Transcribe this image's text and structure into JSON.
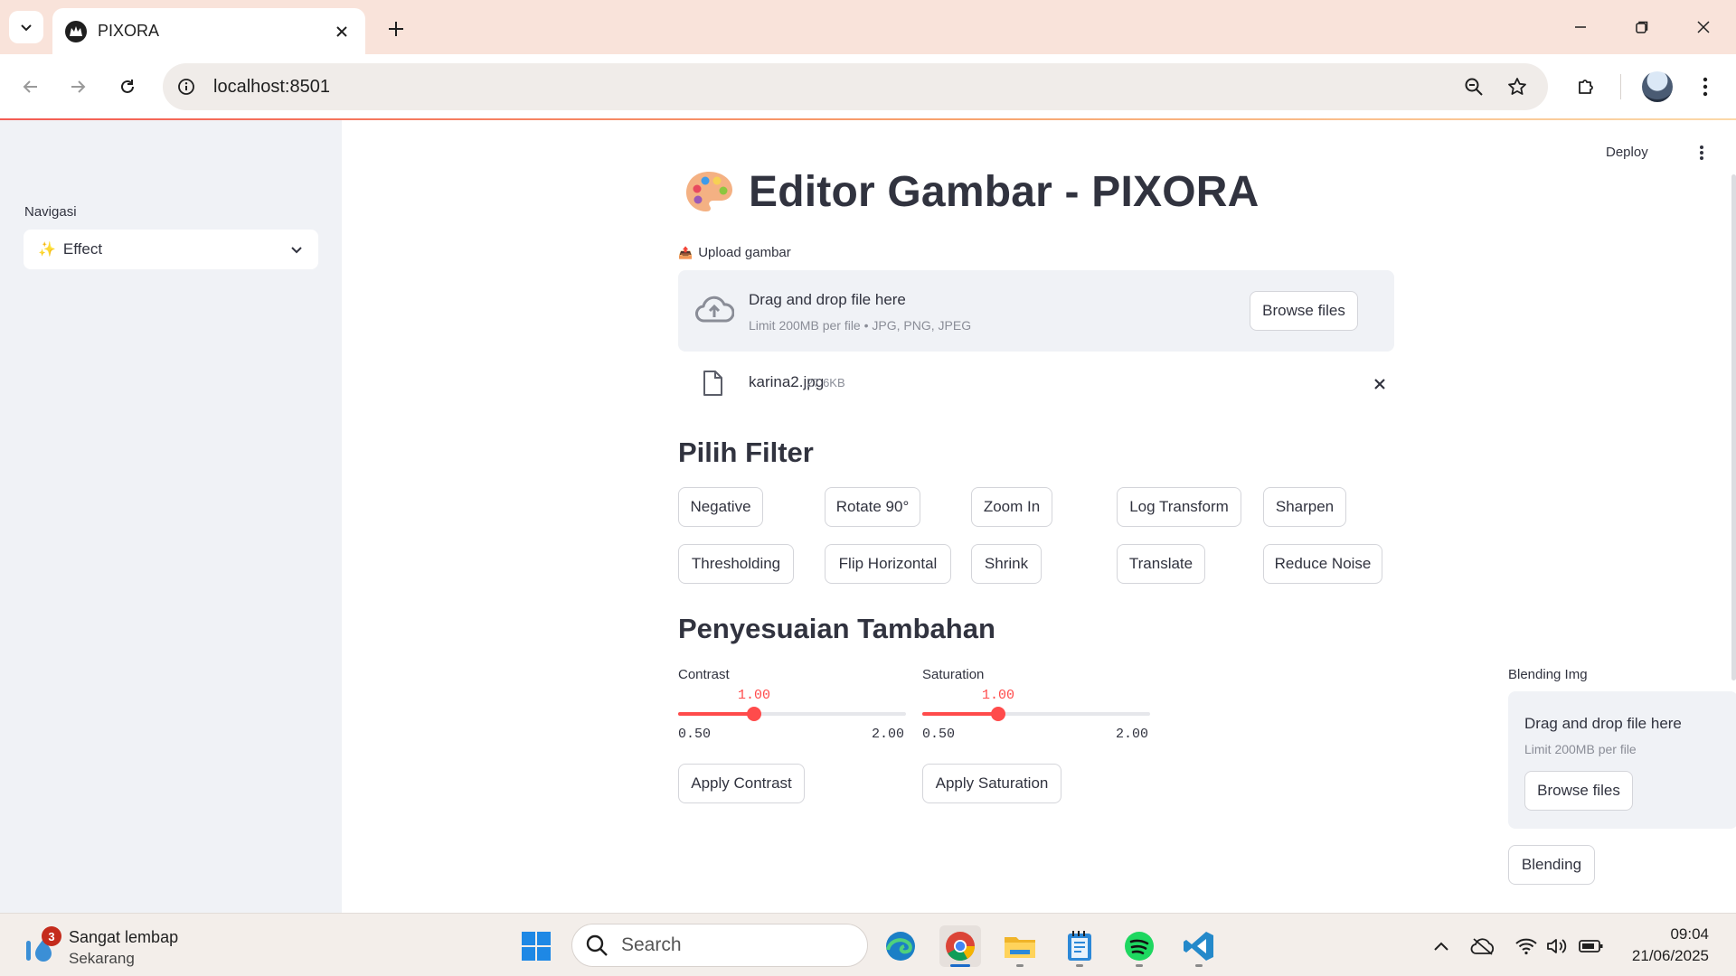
{
  "browser": {
    "tab_title": "PIXORA",
    "url": "localhost:8501"
  },
  "app": {
    "deploy_label": "Deploy",
    "sidebar": {
      "nav_label": "Navigasi",
      "nav_selected_icon": "✨",
      "nav_selected": "Effect"
    },
    "title_icon": "palette-icon",
    "title": "Editor Gambar - PIXORA",
    "upload": {
      "label_icon": "📤",
      "label": "Upload gambar",
      "drop_title": "Drag and drop file here",
      "drop_limit": "Limit 200MB per file • JPG, PNG, JPEG",
      "browse_label": "Browse files",
      "file_name": "karina2.jpg",
      "file_size": "27.6KB"
    },
    "filters": {
      "heading": "Pilih Filter",
      "buttons": [
        "Negative",
        "Rotate 90°",
        "Zoom In",
        "Log Transform",
        "Sharpen",
        "Thresholding",
        "Flip Horizontal",
        "Shrink",
        "Translate",
        "Reduce Noise"
      ]
    },
    "adjust": {
      "heading": "Penyesuaian Tambahan",
      "contrast": {
        "label": "Contrast",
        "value": "1.00",
        "min": "0.50",
        "max": "2.00",
        "fraction": 0.3333,
        "apply_label": "Apply Contrast"
      },
      "saturation": {
        "label": "Saturation",
        "value": "1.00",
        "min": "0.50",
        "max": "2.00",
        "fraction": 0.3333,
        "apply_label": "Apply Saturation"
      },
      "blending": {
        "label": "Blending Img",
        "drop_title": "Drag and drop file here",
        "drop_limit": "Limit 200MB per file",
        "browse_label": "Browse files",
        "blend_label": "Blending"
      }
    },
    "accent_color": "#ff4b4b"
  },
  "taskbar": {
    "weather_badge": "3",
    "weather_title": "Sangat lembap",
    "weather_sub": "Sekarang",
    "search_placeholder": "Search",
    "time": "09:04",
    "date": "21/06/2025"
  }
}
